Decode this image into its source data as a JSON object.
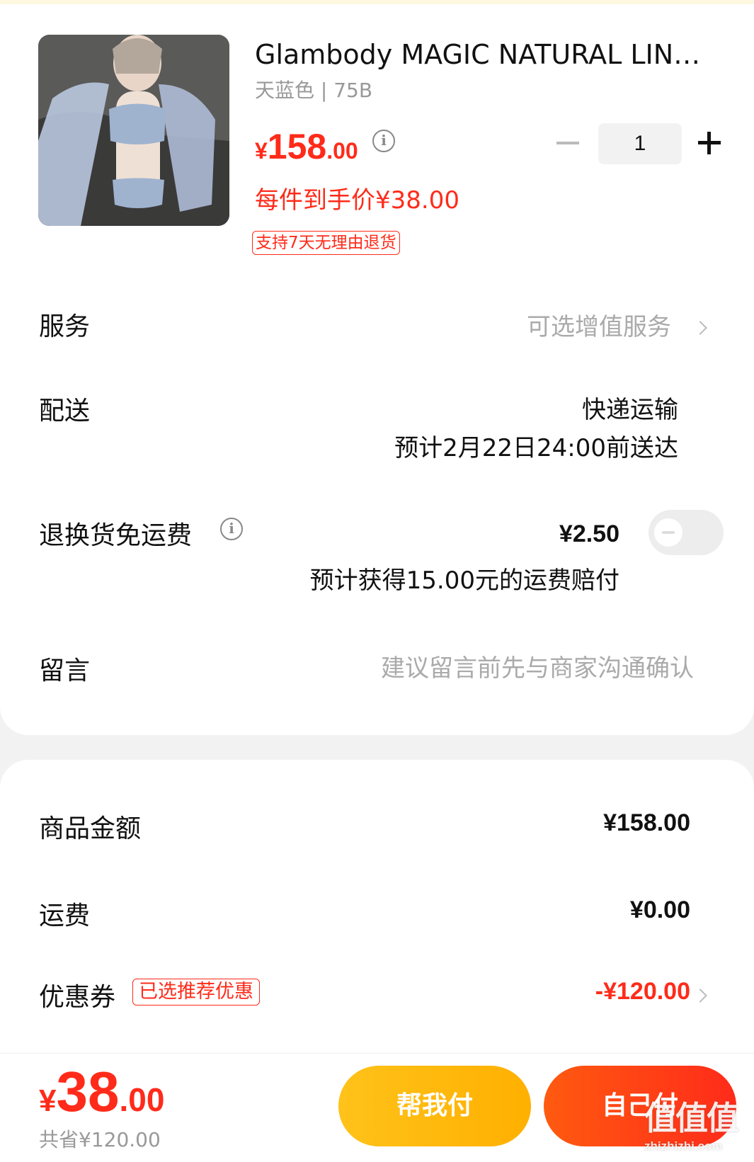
{
  "product": {
    "title": "Glambody MAGIC NATURAL LIN…",
    "sku": "天蓝色 | 75B",
    "price_currency": "¥",
    "price_int": "158",
    "price_dec": ".00",
    "unit_price": "每件到手价¥38.00",
    "return_tag": "支持7天无理由退货",
    "quantity": "1"
  },
  "rows": {
    "service": {
      "label": "服务",
      "value": "可选增值服务"
    },
    "delivery": {
      "label": "配送",
      "method": "快递运输",
      "eta": "预计2月22日24:00前送达"
    },
    "return_shipping": {
      "label": "退换货免运费",
      "price": "¥2.50",
      "note": "预计获得15.00元的运费赔付",
      "enabled": false
    },
    "message": {
      "label": "留言",
      "placeholder": "建议留言前先与商家沟通确认"
    }
  },
  "summary": {
    "goods": {
      "label": "商品金额",
      "value": "¥158.00"
    },
    "shipping": {
      "label": "运费",
      "value": "¥0.00"
    },
    "coupon": {
      "label": "优惠券",
      "tag": "已选推荐优惠",
      "value": "-¥120.00"
    }
  },
  "footer": {
    "total_currency": "¥",
    "total_int": "38",
    "total_dec": ".00",
    "saved": "共省¥120.00",
    "help_pay": "帮我付",
    "self_pay": "自己付"
  },
  "watermark": {
    "main": "值值值",
    "sub": "zhizhizhi.com"
  },
  "colors": {
    "accent_red": "#ff2b1a",
    "help_yellow": "#ffb800"
  }
}
